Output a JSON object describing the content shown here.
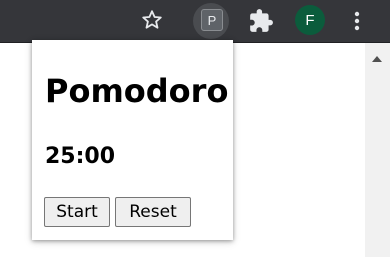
{
  "toolbar": {
    "extension_letter": "P",
    "profile_initial": "F",
    "icons": {
      "bookmark": "star-icon",
      "extension": "pomodoro-extension-icon",
      "extensions_menu": "puzzle-icon",
      "menu": "kebab-menu-icon"
    },
    "colors": {
      "toolbar_bg": "#35363a",
      "avatar_bg": "#0b5c3c"
    }
  },
  "popup": {
    "title": "Pomodoro",
    "timer": "25:00",
    "start_label": "Start",
    "reset_label": "Reset"
  }
}
